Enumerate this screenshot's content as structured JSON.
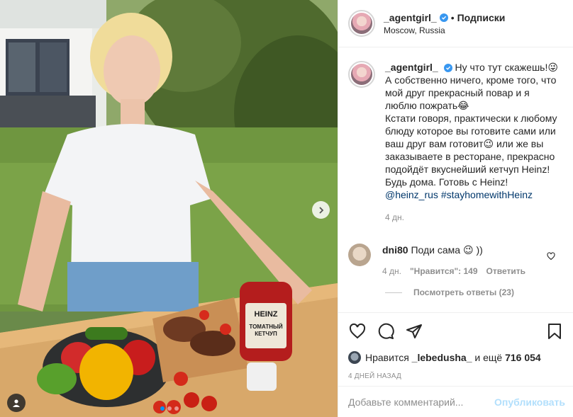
{
  "header": {
    "username": "_agentgirl_",
    "separator": "•",
    "follow_label": "Подписки",
    "location": "Moscow, Russia"
  },
  "caption": {
    "username": "_agentgirl_",
    "lines": [
      "Ну что тут скажешь!😜",
      "А собственно ничего, кроме того, что мой друг прекрасный повар и я люблю пожрать😂",
      "Кстати говоря, практически к любому блюду которое вы готовите сами или ваш друг вам готовит😉 или же вы заказываете в ресторане, прекрасно подойдёт вкуснейший кетчуп Heinz!",
      "Будь дома. Готовь с Heinz!"
    ],
    "mention": "@heinz_rus",
    "hashtag": "#stayhomewithHeinz",
    "age": "4 дн."
  },
  "comment": {
    "username": "dni80",
    "text": "Поди сама 😉 ))",
    "age": "4 дн.",
    "likes": "\"Нравится\": 149",
    "reply_label": "Ответить",
    "view_replies": "Посмотреть ответы (23)"
  },
  "likes": {
    "prefix": "Нравится",
    "user": "_lebedusha_",
    "middle": "и ещё",
    "count": "716 054"
  },
  "date": "4 дней назад",
  "add_comment": {
    "placeholder": "Добавьте комментарий...",
    "post_label": "Опубликовать"
  },
  "photo": {
    "bottle_brand": "HEINZ",
    "bottle_label_line1": "ТОМАТНЫЙ",
    "bottle_label_line2": "КЕТЧУП"
  },
  "carousel": {
    "total": 3,
    "active": 1
  },
  "colors": {
    "accent": "#0095f6",
    "verified": "#3897f0",
    "link": "#00376b"
  }
}
